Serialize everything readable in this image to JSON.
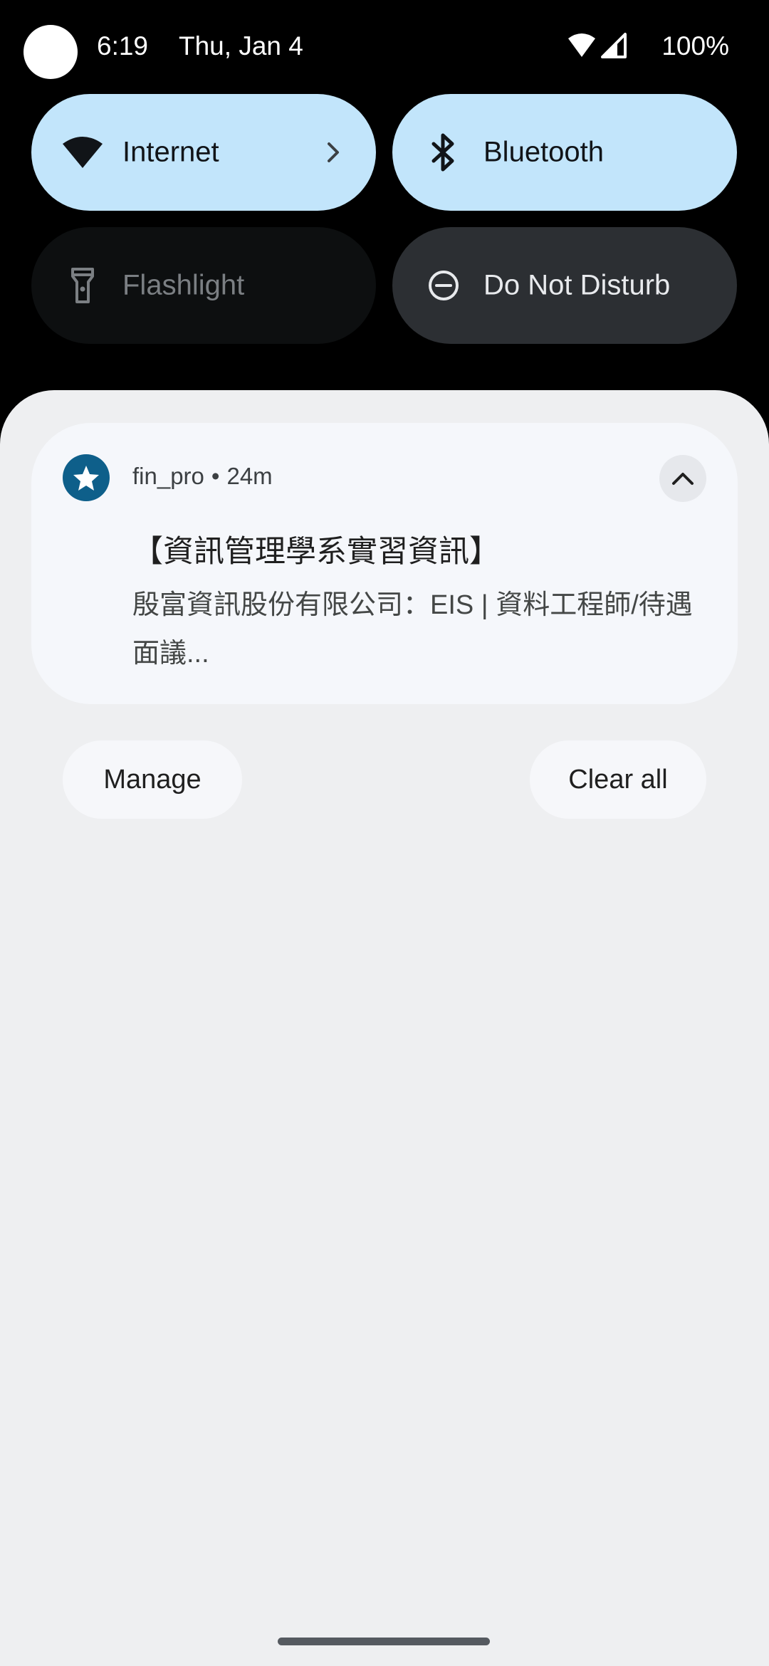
{
  "status_bar": {
    "time": "6:19",
    "date": "Thu, Jan 4",
    "battery": "100%",
    "icons": [
      "wifi-icon",
      "cell-signal-icon"
    ]
  },
  "quick_settings": {
    "tiles": [
      {
        "label": "Internet",
        "icon": "wifi-icon",
        "state": "on"
      },
      {
        "label": "Bluetooth",
        "icon": "bluetooth-icon",
        "state": "on"
      },
      {
        "label": "Flashlight",
        "icon": "flashlight-icon",
        "state": "off"
      },
      {
        "label": "Do Not Disturb",
        "icon": "dnd-icon",
        "state": "off"
      }
    ]
  },
  "notification": {
    "app_name": "fin_pro",
    "separator": "•",
    "time_ago": "24m",
    "title": "【資訊管理學系實習資訊】",
    "body": "殷富資訊股份有限公司：EIS | 資料工程師/待遇面議...",
    "app_icon": "star-icon",
    "app_icon_color": "#0e5f8a"
  },
  "actions": {
    "manage_label": "Manage",
    "clear_all_label": "Clear all"
  },
  "colors": {
    "tile_on": "#c2e5fb",
    "shade_bg": "#eeeff1",
    "card_bg": "#f5f7fb"
  }
}
